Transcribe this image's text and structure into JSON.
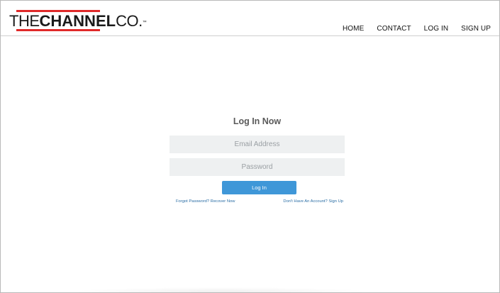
{
  "brand": {
    "logo_the": "THE",
    "logo_channel": "CHANNEL",
    "logo_co": "CO.",
    "logo_tm": "™",
    "accent_color": "#e02a2a"
  },
  "nav": {
    "items": [
      {
        "label": "HOME"
      },
      {
        "label": "CONTACT"
      },
      {
        "label": "LOG IN"
      },
      {
        "label": "SIGN UP"
      }
    ]
  },
  "login": {
    "title": "Log In Now",
    "email_placeholder": "Email Address",
    "email_value": "",
    "password_placeholder": "Password",
    "password_value": "",
    "submit_label": "Log In",
    "button_color": "#3f97d8",
    "forgot_link": "Forgot Password? Recover Now",
    "signup_link": "Don't Have An Account? Sign Up"
  }
}
